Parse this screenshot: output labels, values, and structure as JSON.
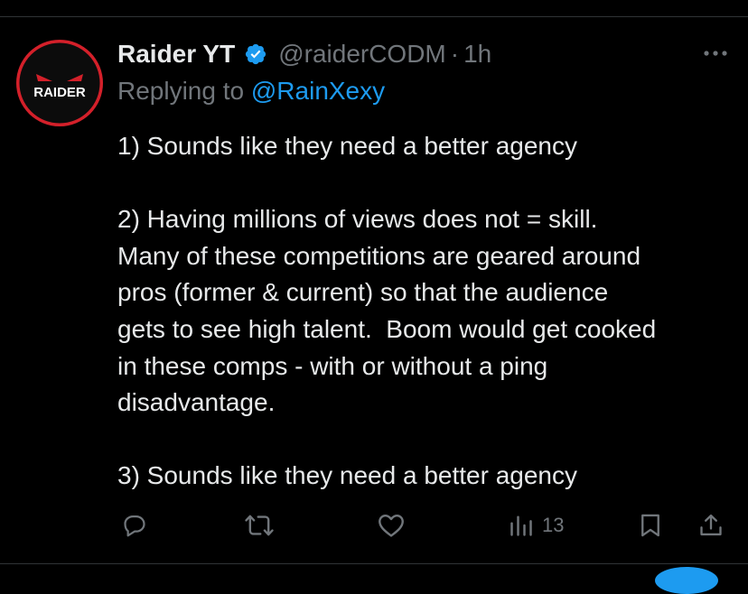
{
  "author": {
    "display_name": "Raider YT",
    "handle": "@raiderCODM",
    "separator": "·",
    "time": "1h",
    "avatar_text": "RAIDER",
    "verified": true
  },
  "reply": {
    "prefix": "Replying to",
    "to": "@RainXexy"
  },
  "tweet": {
    "paragraphs": [
      "1) Sounds like they need a better agency",
      "2) Having millions of views does not = skill.\nMany of these competitions are geared around\npros (former & current) so that the audience\ngets to see high talent.  Boom would get cooked\nin these comps - with or without a ping\ndisadvantage.",
      "3) Sounds like they need a better agency"
    ]
  },
  "actions": {
    "reply_icon": "reply-icon",
    "retweet_icon": "retweet-icon",
    "like_icon": "like-icon",
    "views_icon": "views-icon",
    "views_count": "13",
    "bookmark_icon": "bookmark-icon",
    "share_icon": "share-icon"
  },
  "colors": {
    "background": "#000000",
    "text": "#e7e9ea",
    "muted": "#71767b",
    "link": "#1d9bf0",
    "verified": "#1d9bf0",
    "avatar_ring": "#d4202a"
  }
}
